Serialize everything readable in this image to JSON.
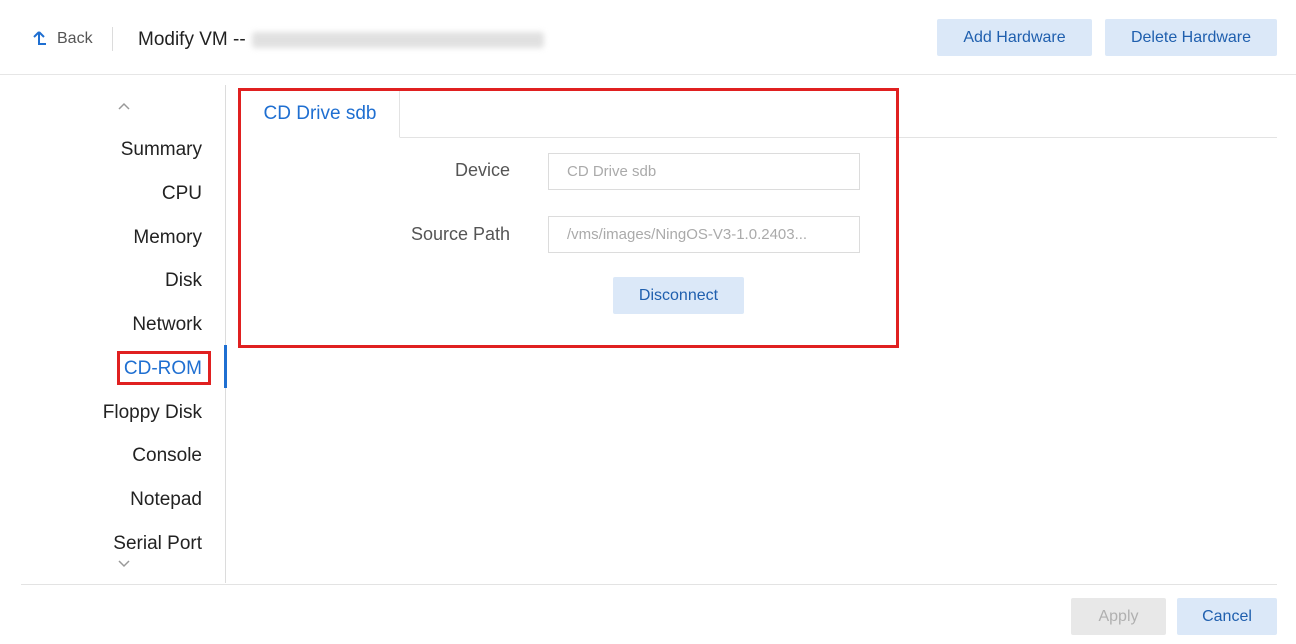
{
  "header": {
    "back_label": "Back",
    "title": "Modify VM --",
    "add_hardware_label": "Add Hardware",
    "delete_hardware_label": "Delete Hardware"
  },
  "sidebar": {
    "items": [
      {
        "label": "Summary"
      },
      {
        "label": "CPU"
      },
      {
        "label": "Memory"
      },
      {
        "label": "Disk"
      },
      {
        "label": "Network"
      },
      {
        "label": "CD-ROM"
      },
      {
        "label": "Floppy Disk"
      },
      {
        "label": "Console"
      },
      {
        "label": "Notepad"
      },
      {
        "label": "Serial Port"
      }
    ],
    "active_item": "CD-ROM"
  },
  "main": {
    "tab_label": "CD Drive sdb",
    "device_label": "Device",
    "device_value": "CD Drive sdb",
    "source_path_label": "Source Path",
    "source_path_value": "/vms/images/NingOS-V3-1.0.2403...",
    "disconnect_label": "Disconnect"
  },
  "footer": {
    "apply_label": "Apply",
    "cancel_label": "Cancel"
  },
  "colors": {
    "accent": "#1f6fd1",
    "button_bg": "#dbe8f8",
    "highlight_box": "#e02020"
  }
}
